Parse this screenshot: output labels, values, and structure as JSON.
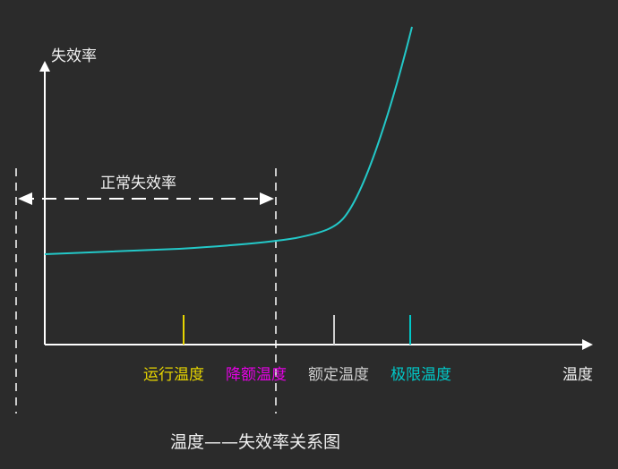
{
  "chart_data": {
    "type": "line",
    "title": "温度——失效率关系图",
    "ylabel": "失效率",
    "xlabel": "温度",
    "annotation": "正常失效率",
    "markers": [
      {
        "label": "运行温度",
        "color": "#e6d400"
      },
      {
        "label": "降额温度",
        "color": "#e600e6"
      },
      {
        "label": "额定温度",
        "color": "#cfcfcf"
      },
      {
        "label": "极限温度",
        "color": "#00c8c8"
      }
    ],
    "curve_color": "#23c8c8"
  },
  "colors": {
    "background": "#2b2b2b",
    "axis": "#ffffff",
    "text": "#f0f0f0"
  }
}
